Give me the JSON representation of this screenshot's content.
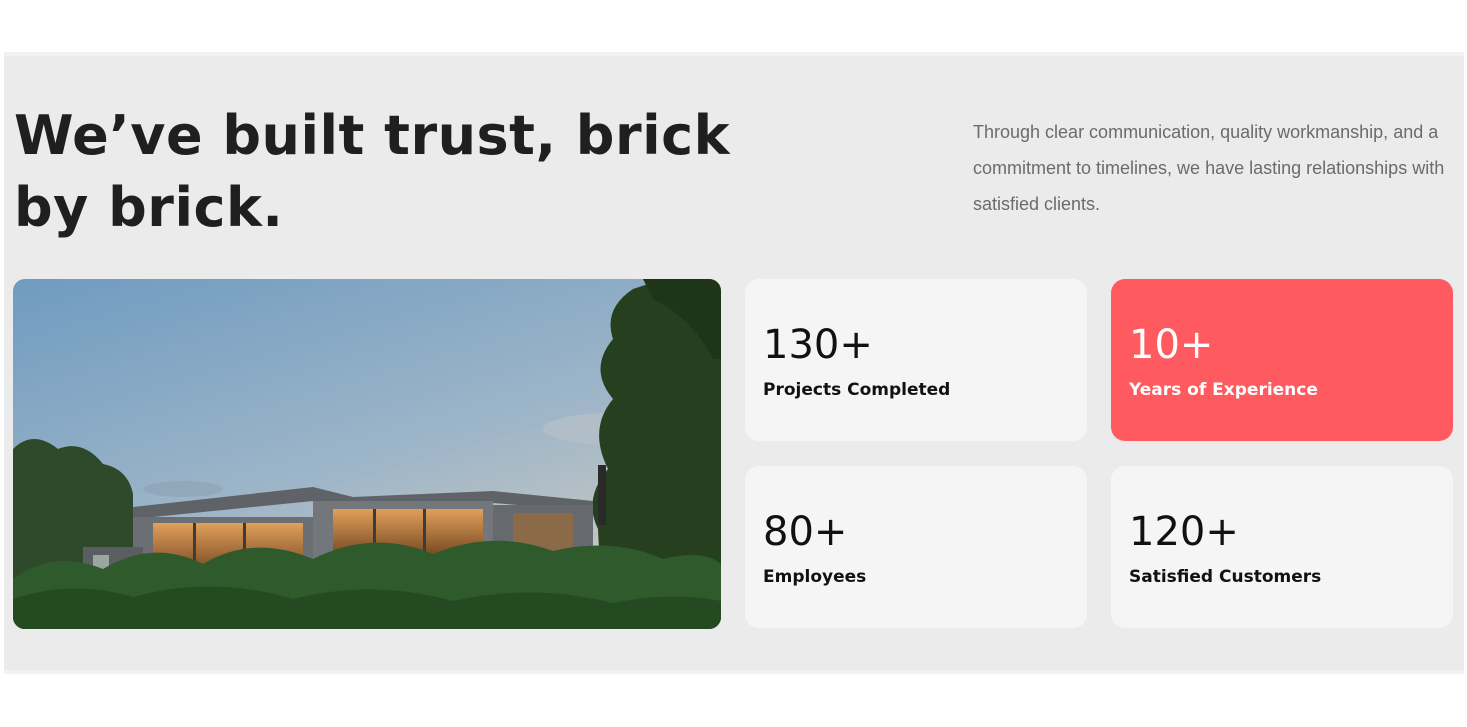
{
  "hero": {
    "headline": "We’ve built trust, brick by brick.",
    "intro": "Through clear communication, quality workmanship, and a commitment to timelines, we have lasting relationships with satisfied clients."
  },
  "photo": {
    "icon": "house-photo"
  },
  "stats": [
    {
      "value": "130+",
      "label": "Projects Completed",
      "highlight": false
    },
    {
      "value": "10+",
      "label": "Years of Experience",
      "highlight": true
    },
    {
      "value": "80+",
      "label": "Employees",
      "highlight": false
    },
    {
      "value": "120+",
      "label": "Satisfied Customers",
      "highlight": false
    }
  ],
  "colors": {
    "accent": "#ff5a5f",
    "section_bg": "#ebebeb",
    "card_bg": "#f5f5f5",
    "heading": "#1f1f1f",
    "body_text": "#6b6b6b"
  }
}
